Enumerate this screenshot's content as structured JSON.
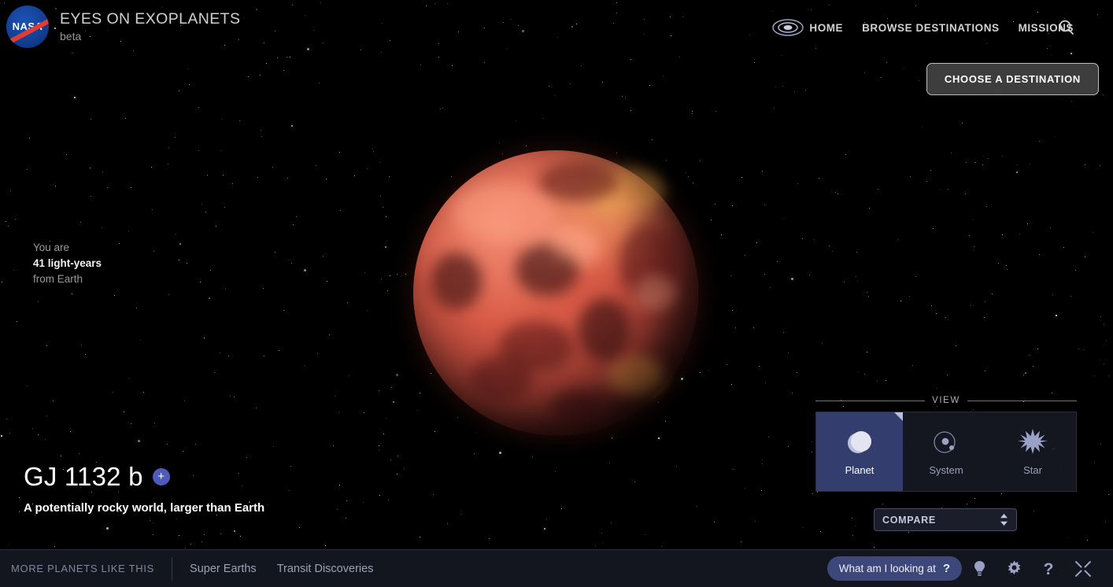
{
  "header": {
    "logo_alt": "NASA",
    "title": "EYES ON EXOPLANETS",
    "subtitle": "beta",
    "galaxy_icon": "galaxy-icon",
    "nav": [
      {
        "label": "HOME",
        "name": "nav-home"
      },
      {
        "label": "BROWSE DESTINATIONS",
        "name": "nav-browse-destinations"
      },
      {
        "label": "MISSIONS",
        "name": "nav-missions"
      }
    ],
    "search_icon": "search-icon"
  },
  "choose_destination": {
    "label": "CHOOSE A DESTINATION"
  },
  "distance": {
    "line1": "You are",
    "value": "41 light-years",
    "line3": "from Earth"
  },
  "planet": {
    "name": "GJ 1132 b",
    "add_badge": "+",
    "description": "A potentially rocky world, larger than Earth"
  },
  "view_panel": {
    "heading": "VIEW",
    "tabs": [
      {
        "label": "Planet",
        "icon": "planet-icon",
        "selected": true
      },
      {
        "label": "System",
        "icon": "system-orbit-icon",
        "selected": false
      },
      {
        "label": "Star",
        "icon": "star-burst-icon",
        "selected": false
      }
    ]
  },
  "compare": {
    "label": "COMPARE",
    "stepper_icon": "stepper-arrows-icon"
  },
  "bottom_bar": {
    "more_label": "MORE PLANETS LIKE THIS",
    "tags": [
      {
        "label": "Super Earths"
      },
      {
        "label": "Transit Discoveries"
      }
    ],
    "what_am_i_looking_at": {
      "label": "What am I looking at",
      "mark": "?"
    },
    "icons": [
      {
        "name": "lightbulb-icon"
      },
      {
        "name": "gear-icon"
      },
      {
        "name": "help-question-icon"
      },
      {
        "name": "fullscreen-icon"
      }
    ]
  },
  "colors": {
    "accent_blue": "#3d4779",
    "selected_tab": "#343e6e",
    "badge_blue": "#4f5bb8",
    "bottom_bar": "#13161f",
    "planet_red": "#d85a46"
  }
}
